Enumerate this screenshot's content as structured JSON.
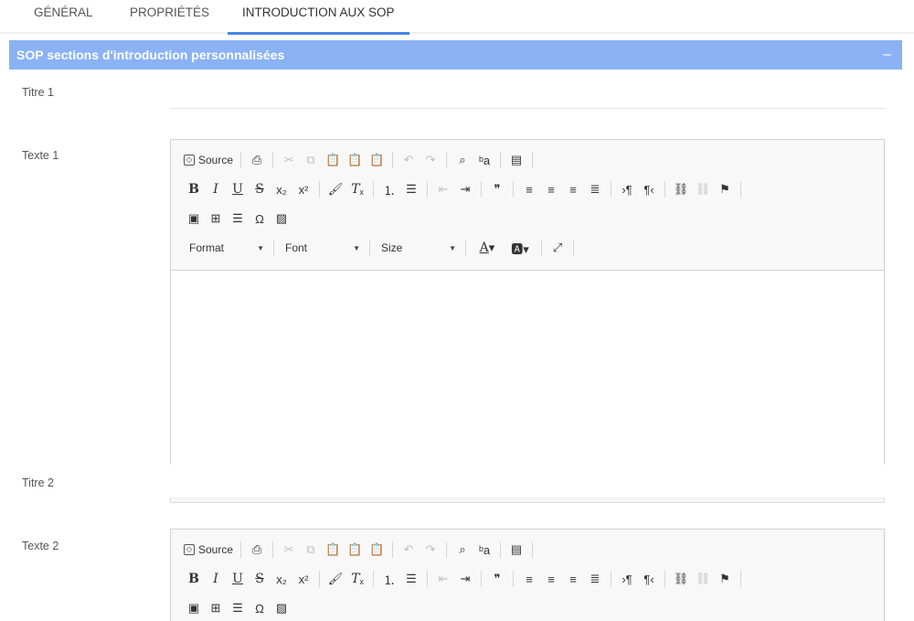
{
  "tabs": [
    {
      "label": "GÉNÉRAL"
    },
    {
      "label": "PROPRIÉTÉS"
    },
    {
      "label": "INTRODUCTION AUX SOP"
    }
  ],
  "section": {
    "title": "SOP sections d'introduction personnalisées",
    "collapse_symbol": "–"
  },
  "fields": {
    "titre1_label": "Titre 1",
    "texte1_label": "Texte 1",
    "titre2_label": "Titre 2",
    "texte2_label": "Texte 2"
  },
  "editor": {
    "source_label": "Source",
    "format_label": "Format",
    "font_label": "Font",
    "size_label": "Size"
  },
  "colors": {
    "accent": "#4a86e8",
    "section_header": "#8ab2f5"
  }
}
